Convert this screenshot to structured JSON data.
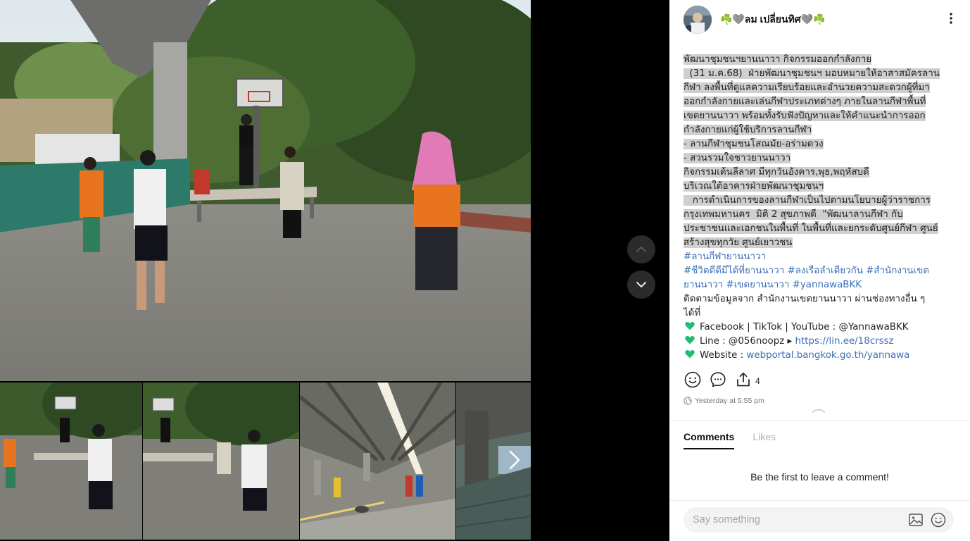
{
  "post": {
    "author": "☘️🩶ลม เปลี่ยนทิศ🩶☘️",
    "lines_highlighted": [
      "พัฒนาชุมชนฯยานนาวา กิจกรรมออกกำลังกาย",
      "  (31 ม.ค.68)  ฝ่ายพัฒนาชุมชนฯ มอบหมายให้อาสาสมัครลาน",
      "กีฬา ลงพื้นที่ดูแลความเรียบร้อยและอำนวยความสะดวกผู้ที่มา",
      "ออกกำลังกายและเล่นกีฬาประเภทต่างๆ ภายในลานกีฬาพื้นที่",
      "เขตยานนาวา พร้อมทั้งรับฟังปัญหาและให้คำแนะนำการออก",
      "กำลังกายแก่ผู้ใช้บริการลานกีฬา",
      "- ลานกีฬาชุมชนโสณมัย-อร่ามดวง",
      "- สวนรวมใจชาวยานนาวา",
      "กิจกรรมเต้นลีลาศ มีทุกวันอังคาร,พุธ,พฤหัสบดี",
      "บริเวณใต้อาคารฝ่ายพัฒนาชุมชนฯ",
      "   การดำเนินการของลานกีฬาเป็นไปตามนโยบายผู้ว่าราชการ",
      "กรุงเทพมหานคร  มิติ 2 สุขภาพดี  \"พัฒนาลานกีฬา กับ",
      "ประชาชนและเอกชนในพื้นที่ ในพื้นที่และยกระดับศูนย์กีฬา ศูนย์",
      "สร้างสุขทุกวัย ศูนย์เยาวชน"
    ],
    "tag_line_1": "#ลานกีฬายานนาวา",
    "tag_line_2": "#ชีวิตดีดีมีได้ที่ยานนาวา #ลงเรือลำเดียวกัน #สำนักงานเขต",
    "tag_line_3": "ยานนาวา #เขตยานนาวา #yannawaBKK",
    "follow_line_1": "ติดตามข้อมูลจาก สำนักงานเขตยานนาวา ผ่านช่องทางอื่น ๆ",
    "follow_line_2": "ได้ที่",
    "facebook_text": "Facebook | TikTok | YouTube : @YannawaBKK",
    "line_prefix": "Line : @056noopz ▸ ",
    "line_url": "https://lin.ee/18crssz",
    "website_prefix": "Website : ",
    "website_url": "webportal.bangkok.go.th/yannawa",
    "share_count": "4",
    "timestamp": "Yesterday at 5:55 pm"
  },
  "tabs": {
    "comments": "Comments",
    "likes": "Likes"
  },
  "empty_comments": "Be the first to leave a comment!",
  "composer": {
    "placeholder": "Say something"
  },
  "colors": {
    "highlight": "#cfcfcf",
    "link": "#3b6fb6",
    "heart": "#1dbf73"
  }
}
